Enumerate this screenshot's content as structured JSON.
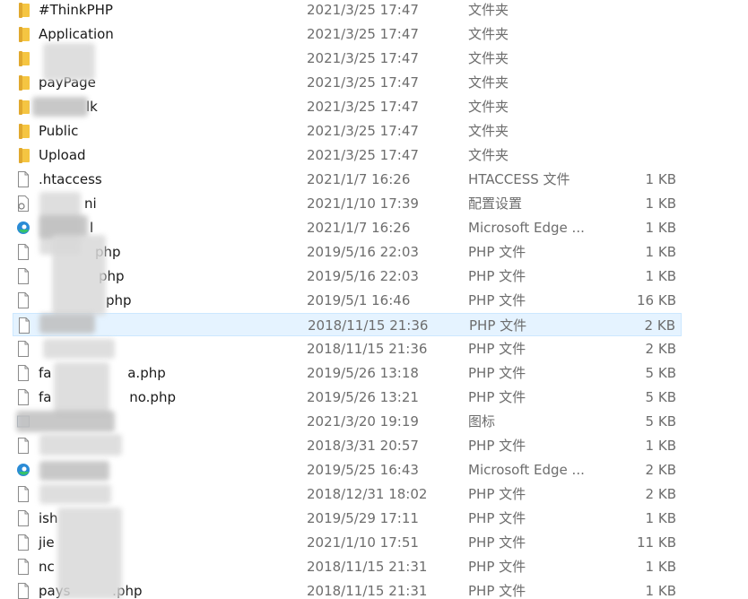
{
  "colors": {
    "folder": "#f5c542",
    "folder_dark": "#e0a82e",
    "doc_stroke": "#8a8a8a",
    "selected_bg": "#e5f3ff",
    "edge_blue": "#2b8bd6",
    "edge_green": "#35c26b"
  },
  "files": [
    {
      "name": "#ThinkPHP",
      "date": "2021/3/25 17:47",
      "type": "文件夹",
      "size": "",
      "icon": "folder-icon"
    },
    {
      "name": "Application",
      "date": "2021/3/25 17:47",
      "type": "文件夹",
      "size": "",
      "icon": "folder-icon"
    },
    {
      "name": "",
      "date": "2021/3/25 17:47",
      "type": "文件夹",
      "size": "",
      "icon": "folder-icon"
    },
    {
      "name": "payPage",
      "date": "2021/3/25 17:47",
      "type": "文件夹",
      "size": "",
      "icon": "folder-icon"
    },
    {
      "name": "lk",
      "date": "2021/3/25 17:47",
      "type": "文件夹",
      "size": "",
      "icon": "folder-icon"
    },
    {
      "name": "Public",
      "date": "2021/3/25 17:47",
      "type": "文件夹",
      "size": "",
      "icon": "folder-icon"
    },
    {
      "name": "Upload",
      "date": "2021/3/25 17:47",
      "type": "文件夹",
      "size": "",
      "icon": "folder-icon"
    },
    {
      "name": ".htaccess",
      "date": "2021/1/7 16:26",
      "type": "HTACCESS 文件",
      "size": "1 KB",
      "icon": "document-icon"
    },
    {
      "name": "ni",
      "date": "2021/1/10 17:39",
      "type": "配置设置",
      "size": "1 KB",
      "icon": "settings-file-icon"
    },
    {
      "name": "l",
      "date": "2021/1/7 16:26",
      "type": "Microsoft Edge ...",
      "size": "1 KB",
      "icon": "edge-icon"
    },
    {
      "name": "php",
      "date": "2019/5/16 22:03",
      "type": "PHP 文件",
      "size": "1 KB",
      "icon": "document-icon"
    },
    {
      "name": "php",
      "date": "2019/5/16 22:03",
      "type": "PHP 文件",
      "size": "1 KB",
      "icon": "document-icon"
    },
    {
      "name": "php",
      "date": "2019/5/1 16:46",
      "type": "PHP 文件",
      "size": "16 KB",
      "icon": "document-icon"
    },
    {
      "name": "",
      "date": "2018/11/15 21:36",
      "type": "PHP 文件",
      "size": "2 KB",
      "icon": "document-icon"
    },
    {
      "name": "",
      "date": "2018/11/15 21:36",
      "type": "PHP 文件",
      "size": "2 KB",
      "icon": "document-icon"
    },
    {
      "name": "fa a.php",
      "date": "2019/5/26 13:18",
      "type": "PHP 文件",
      "size": "5 KB",
      "icon": "document-icon"
    },
    {
      "name": "fa no.php",
      "date": "2019/5/26 13:21",
      "type": "PHP 文件",
      "size": "5 KB",
      "icon": "document-icon"
    },
    {
      "name": "",
      "date": "2021/3/20 19:19",
      "type": "图标",
      "size": "5 KB",
      "icon": "image-file-icon"
    },
    {
      "name": "",
      "date": "2018/3/31 20:57",
      "type": "PHP 文件",
      "size": "1 KB",
      "icon": "document-icon"
    },
    {
      "name": "",
      "date": "2019/5/25 16:43",
      "type": "Microsoft Edge ...",
      "size": "2 KB",
      "icon": "edge-icon"
    },
    {
      "name": "",
      "date": "2018/12/31 18:02",
      "type": "PHP 文件",
      "size": "2 KB",
      "icon": "document-icon"
    },
    {
      "name": "ish",
      "date": "2019/5/29 17:11",
      "type": "PHP 文件",
      "size": "1 KB",
      "icon": "document-icon"
    },
    {
      "name": "jie",
      "date": "2021/1/10 17:51",
      "type": "PHP 文件",
      "size": "11 KB",
      "icon": "document-icon"
    },
    {
      "name": "nc",
      "date": "2018/11/15 21:31",
      "type": "PHP 文件",
      "size": "1 KB",
      "icon": "document-icon"
    },
    {
      "name": "pays .php",
      "date": "2018/11/15 21:31",
      "type": "PHP 文件",
      "size": "1 KB",
      "icon": "document-icon"
    }
  ]
}
